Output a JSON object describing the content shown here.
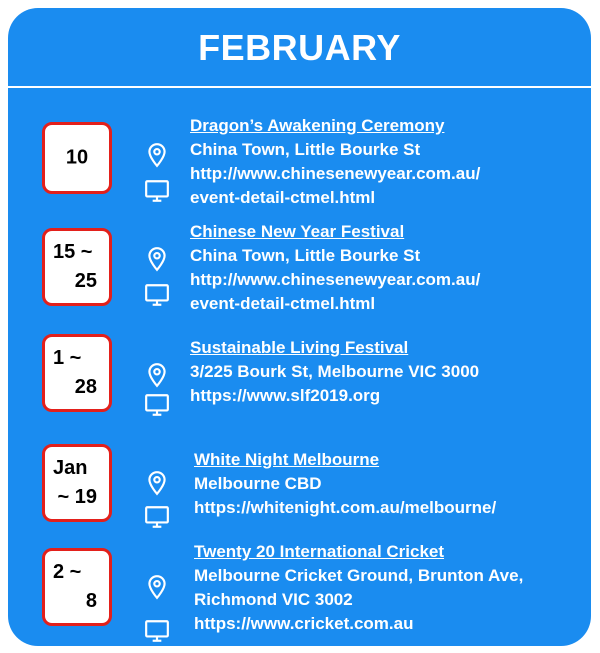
{
  "header": {
    "title": "FEBRUARY"
  },
  "events": [
    {
      "date_lines": [
        "10"
      ],
      "title": "Dragon’s Awakening Ceremony",
      "location": "China Town, Little Bourke St",
      "url_lines": [
        "http://www.chinesenewyear.com.au/",
        "event-detail-ctmel.html"
      ]
    },
    {
      "date_lines": [
        "15 ~",
        "25"
      ],
      "title": "Chinese New Year Festival",
      "location": "China Town, Little Bourke St",
      "url_lines": [
        "http://www.chinesenewyear.com.au/",
        "event-detail-ctmel.html"
      ]
    },
    {
      "date_lines": [
        "1 ~",
        "28"
      ],
      "title": "Sustainable Living Festival",
      "location": "3/225 Bourk St, Melbourne VIC 3000",
      "url_lines": [
        "https://www.slf2019.org"
      ]
    },
    {
      "date_lines": [
        "Jan",
        "~ 19"
      ],
      "title": "White Night Melbourne",
      "location": "Melbourne CBD",
      "url_lines": [
        "https://whitenight.com.au/melbourne/"
      ]
    },
    {
      "date_lines": [
        "2 ~",
        "8"
      ],
      "title": "Twenty 20 International Cricket",
      "location_lines": [
        "Melbourne Cricket Ground, Brunton Ave,",
        "Richmond VIC 3002"
      ],
      "url_lines": [
        "https://www.cricket.com.au"
      ]
    }
  ],
  "colors": {
    "background": "#1a8cf0",
    "date_border": "#e3201b",
    "text": "#ffffff"
  },
  "icons": {
    "location": "map-pin-icon",
    "website": "monitor-icon"
  }
}
